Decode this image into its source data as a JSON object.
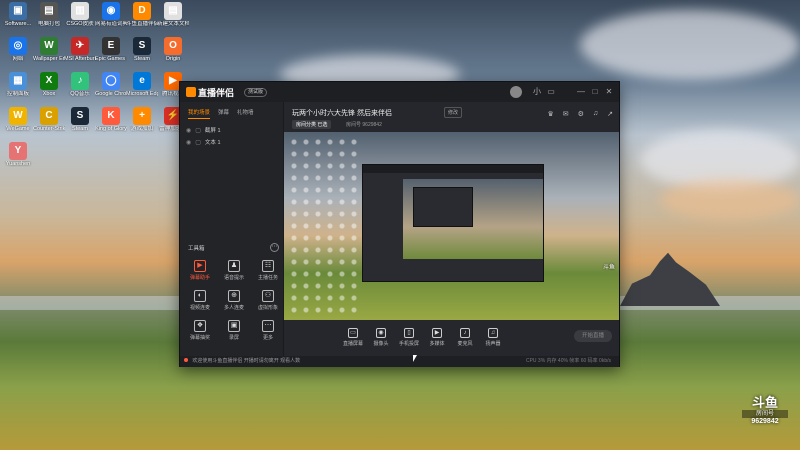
{
  "desktop": {
    "icons": [
      {
        "label": "Software...",
        "color": "#3a6ea5",
        "glyph": "▣"
      },
      {
        "label": "电脑打包",
        "color": "#555",
        "glyph": "▤"
      },
      {
        "label": "CSGO皮肤",
        "color": "#e0e0e0",
        "glyph": "▥"
      },
      {
        "label": "网易有道词典",
        "color": "#1a73e8",
        "glyph": "◉"
      },
      {
        "label": "斗鱼直播伴侣",
        "color": "#ff8a00",
        "glyph": "D"
      },
      {
        "label": "新建文本文档",
        "color": "#e0e0e0",
        "glyph": "▤"
      },
      {
        "label": "网络",
        "color": "#1a73e8",
        "glyph": "◎"
      },
      {
        "label": "Wallpaper Engine",
        "color": "#2e7d32",
        "glyph": "W"
      },
      {
        "label": "MSI Afterburner",
        "color": "#c62828",
        "glyph": "✈"
      },
      {
        "label": "Epic Games Launcher",
        "color": "#333",
        "glyph": "E"
      },
      {
        "label": "Steam",
        "color": "#1b2838",
        "glyph": "S"
      },
      {
        "label": "Origin",
        "color": "#f56c2d",
        "glyph": "O"
      },
      {
        "label": "控制面板",
        "color": "#4a90d9",
        "glyph": "▦"
      },
      {
        "label": "Xbox",
        "color": "#107c10",
        "glyph": "X"
      },
      {
        "label": "QQ音乐",
        "color": "#31c27c",
        "glyph": "♪"
      },
      {
        "label": "Google Chrome",
        "color": "#4285f4",
        "glyph": "◯"
      },
      {
        "label": "Microsoft Edge",
        "color": "#0078d7",
        "glyph": "e"
      },
      {
        "label": "腾讯视频",
        "color": "#ff6a00",
        "glyph": "▶"
      },
      {
        "label": "WeGame",
        "color": "#f0b400",
        "glyph": "W"
      },
      {
        "label": "Counter-Strike Global Offensive",
        "color": "#d9a000",
        "glyph": "C"
      },
      {
        "label": "Steam",
        "color": "#1b2838",
        "glyph": "S"
      },
      {
        "label": "King of Glory",
        "color": "#ff5a3c",
        "glyph": "K"
      },
      {
        "label": "游戏加加",
        "color": "#ff8a00",
        "glyph": "+"
      },
      {
        "label": "雷神加速器",
        "color": "#d93025",
        "glyph": "⚡"
      },
      {
        "label": "Yuanshen",
        "color": "#e57373",
        "glyph": "Y"
      }
    ]
  },
  "app": {
    "name": "直播伴侣",
    "version": "测试版",
    "window_controls": [
      "小",
      "▭",
      "—",
      "□",
      "✕"
    ],
    "left_tabs": [
      {
        "label": "我的场景",
        "active": true
      },
      {
        "label": "弹幕",
        "active": false
      },
      {
        "label": "礼物墙",
        "active": false
      }
    ],
    "scenes": [
      {
        "label": "截屏 1"
      },
      {
        "label": "文本 1"
      }
    ],
    "tools_title": "工具箱",
    "tools": [
      {
        "label": "弹幕助手",
        "glyph": "▶",
        "hot": true
      },
      {
        "label": "语音提示",
        "glyph": "♟",
        "hot": false
      },
      {
        "label": "主播任务",
        "glyph": "☷",
        "hot": false
      },
      {
        "label": "视频连麦",
        "glyph": "◐",
        "hot": false
      },
      {
        "label": "多人连麦",
        "glyph": "⊕",
        "hot": false
      },
      {
        "label": "虚拟形象",
        "glyph": "⚇",
        "hot": false
      },
      {
        "label": "弹幕抽奖",
        "glyph": "❖",
        "hot": false
      },
      {
        "label": "录屏",
        "glyph": "▣",
        "hot": false
      },
      {
        "label": "更多",
        "glyph": "⋯",
        "hot": false
      }
    ],
    "room": {
      "title": "玩两个小时六大先锋 然后来伴侣",
      "edit_label": "修改",
      "tag": "房间分类 已选",
      "sub": "房间号 9629842",
      "icons": [
        "♛",
        "✉",
        "⚙",
        "♫",
        "↗"
      ]
    },
    "bottom_buttons": [
      {
        "label": "直播屏幕",
        "glyph": "▭"
      },
      {
        "label": "摄像头",
        "glyph": "◉"
      },
      {
        "label": "手机投屏",
        "glyph": "▯"
      },
      {
        "label": "多媒体",
        "glyph": "▶"
      },
      {
        "label": "麦克风",
        "glyph": "♪"
      },
      {
        "label": "扬声器",
        "glyph": "♫"
      }
    ],
    "start_label": "开始直播",
    "status_text": "欢迎使用斗鱼直播伴侣 开播时请勿离开 观看人数",
    "status_stats": "CPU 3%  内存 40%  帧率 60  码率 0kb/s"
  },
  "overlay": {
    "brand": "斗鱼",
    "room_label": "房间号",
    "room_number": "9629842"
  }
}
